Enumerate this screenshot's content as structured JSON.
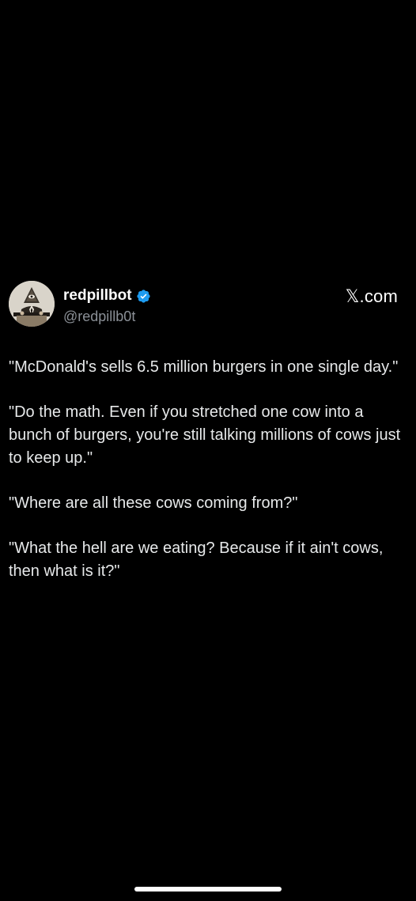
{
  "post": {
    "author": {
      "display_name": "redpillbot",
      "handle": "@redpillb0t",
      "verified": true,
      "avatar_icon": "pyramid-eye-figure-icon",
      "verified_icon": "verified-badge-icon",
      "verified_color": "#1d9bf0"
    },
    "watermark": "𝕏.com",
    "paragraphs": [
      "\"McDonald's sells 6.5 million burgers in one single day.\"",
      "\"Do the math. Even if you stretched one cow into a bunch of burgers, you're still talking millions of cows just to keep up.\"",
      "\"Where are all these cows coming from?\"",
      "\"What the hell are we eating? Because if it ain't cows, then what is it?\""
    ]
  },
  "colors": {
    "background": "#000000",
    "text": "#e7e9ea",
    "secondary_text": "#8b9097"
  }
}
